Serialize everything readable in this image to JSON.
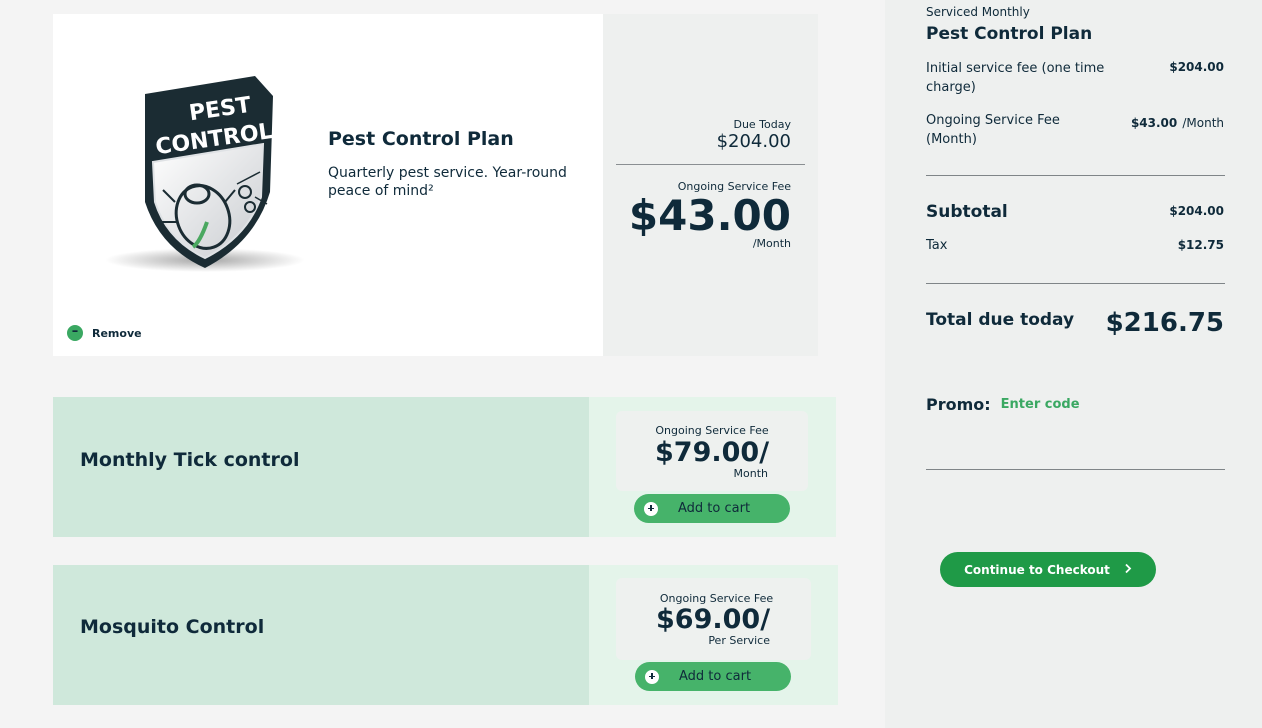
{
  "plan": {
    "image_text_line1": "PEST",
    "image_text_line2": "CONTROL",
    "title": "Pest Control Plan",
    "description": "Quarterly pest service. Year-round peace of mind²",
    "remove_label": "Remove",
    "due_today_label": "Due Today",
    "due_today_value": "$204.00",
    "ongoing_label": "Ongoing Service Fee",
    "ongoing_value": "$43.00",
    "ongoing_unit": "/Month"
  },
  "addons": [
    {
      "title": "Monthly Tick control",
      "fee_label": "Ongoing Service Fee",
      "price": "$79.00/",
      "unit": "Month",
      "button_label": "Add to cart"
    },
    {
      "title": "Mosquito Control",
      "fee_label": "Ongoing Service Fee",
      "price": "$69.00/",
      "unit": "Per Service",
      "button_label": "Add to cart"
    }
  ],
  "summary": {
    "frequency": "Serviced Monthly",
    "plan_name": "Pest Control Plan",
    "initial_fee_label": "Initial service fee (one time charge)",
    "initial_fee_value": "$204.00",
    "ongoing_fee_label": "Ongoing Service Fee (Month)",
    "ongoing_fee_value": "$43.00",
    "ongoing_fee_unit": "/Month",
    "subtotal_label": "Subtotal",
    "subtotal_value": "$204.00",
    "tax_label": "Tax",
    "tax_value": "$12.75",
    "total_label": "Total due today",
    "total_value": "$216.75",
    "promo_label": "Promo:",
    "promo_placeholder": "Enter code",
    "checkout_label": "Continue to Checkout"
  },
  "colors": {
    "brand_green": "#1f9a47",
    "button_green": "#46b36a",
    "card_mint": "#cfe8db",
    "text_navy": "#0f2a3a"
  }
}
